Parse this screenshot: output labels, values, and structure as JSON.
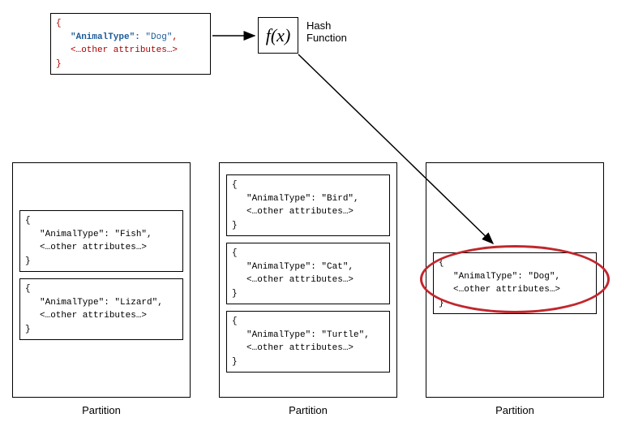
{
  "input": {
    "key_label": "\"AnimalType\"",
    "value": "\"Dog\"",
    "other": "<…other attributes…>"
  },
  "hash": {
    "symbol": "f(x)",
    "label": "Hash\nFunction"
  },
  "partitions": [
    {
      "label": "Partition",
      "records": [
        {
          "key_label": "\"AnimalType\"",
          "value": "\"Fish\"",
          "other": "<…other attributes…>"
        },
        {
          "key_label": "\"AnimalType\"",
          "value": "\"Lizard\"",
          "other": "<…other attributes…>"
        }
      ]
    },
    {
      "label": "Partition",
      "records": [
        {
          "key_label": "\"AnimalType\"",
          "value": "\"Bird\"",
          "other": "<…other attributes…>"
        },
        {
          "key_label": "\"AnimalType\"",
          "value": "\"Cat\"",
          "other": "<…other attributes…>"
        },
        {
          "key_label": "\"AnimalType\"",
          "value": "\"Turtle\"",
          "other": "<…other attributes…>"
        }
      ]
    },
    {
      "label": "Partition",
      "records": [
        {
          "key_label": "\"AnimalType\"",
          "value": "\"Dog\"",
          "other": "<…other attributes…>"
        }
      ]
    }
  ]
}
